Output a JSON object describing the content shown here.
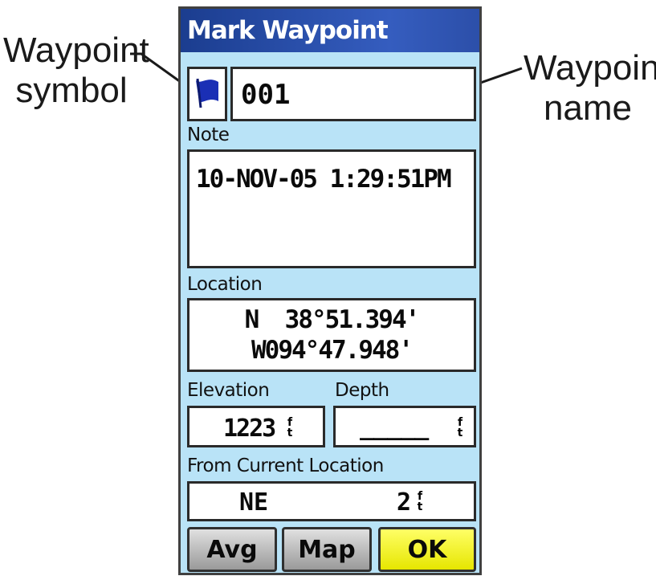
{
  "callouts": {
    "left_line1": "Waypoint",
    "left_line2": "symbol",
    "right_line1": "Waypoint",
    "right_line2": "name"
  },
  "window": {
    "title": "Mark Waypoint"
  },
  "waypoint": {
    "symbol_icon": "blue-flag-icon",
    "name": "001"
  },
  "note": {
    "label": "Note",
    "value": "10-NOV-05 1:29:51PM"
  },
  "location": {
    "label": "Location",
    "lat": "N  38°51.394'",
    "lon": "W094°47.948'"
  },
  "elevation": {
    "label": "Elevation",
    "value": "1223",
    "unit_top": "f",
    "unit_bottom": "t"
  },
  "depth": {
    "label": "Depth",
    "value": "_____",
    "unit_top": "f",
    "unit_bottom": "t"
  },
  "from_current": {
    "label": "From Current Location",
    "bearing": "NE",
    "distance": "2",
    "unit_top": "f",
    "unit_bottom": "t"
  },
  "buttons": {
    "avg": "Avg",
    "map": "Map",
    "ok": "OK"
  },
  "colors": {
    "panel": "#b9e3f7",
    "title_bar": "#1b3d8f",
    "ok_button": "#ffff33",
    "flag": "#1a2fb5"
  }
}
